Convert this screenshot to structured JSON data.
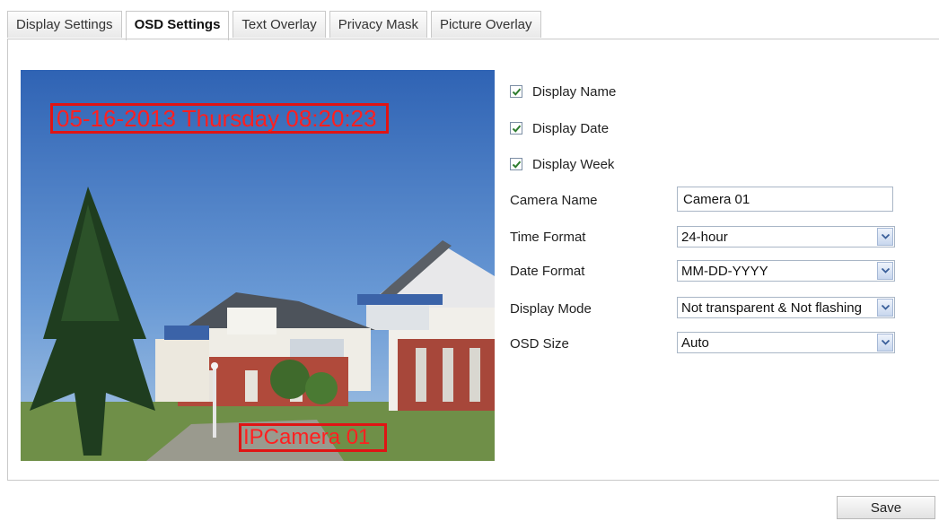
{
  "tabs": [
    {
      "label": "Display Settings",
      "active": false
    },
    {
      "label": "OSD Settings",
      "active": true
    },
    {
      "label": "Text Overlay",
      "active": false
    },
    {
      "label": "Privacy Mask",
      "active": false
    },
    {
      "label": "Picture Overlay",
      "active": false
    }
  ],
  "preview": {
    "date_overlay": "05-16-2013 Thursday 08:20:23",
    "name_overlay": "IPCamera 01",
    "overlay_color": "#e01414"
  },
  "options": {
    "display_name": {
      "label": "Display Name",
      "checked": true
    },
    "display_date": {
      "label": "Display Date",
      "checked": true
    },
    "display_week": {
      "label": "Display Week",
      "checked": true
    }
  },
  "fields": {
    "camera_name": {
      "label": "Camera Name",
      "value": "Camera 01"
    },
    "time_format": {
      "label": "Time Format",
      "value": "24-hour"
    },
    "date_format": {
      "label": "Date Format",
      "value": "MM-DD-YYYY"
    },
    "display_mode": {
      "label": "Display Mode",
      "value": "Not transparent & Not flashing"
    },
    "osd_size": {
      "label": "OSD Size",
      "value": "Auto"
    }
  },
  "actions": {
    "save_label": "Save"
  },
  "icons": {
    "checkbox": "checkmark-icon",
    "dropdown": "chevron-down-icon"
  }
}
